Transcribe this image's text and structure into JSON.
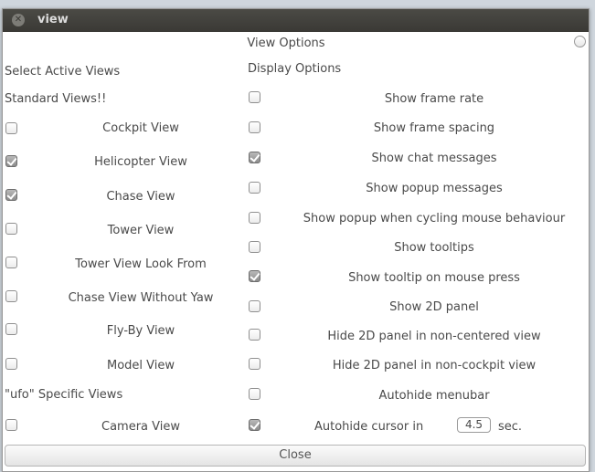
{
  "window": {
    "title": "view",
    "close_icon": "close-icon"
  },
  "header": {
    "title": "View Options"
  },
  "left": {
    "heading": "Select Active Views",
    "standard_label": "Standard Views!!",
    "items": [
      {
        "label": "Cockpit View",
        "checked": false
      },
      {
        "label": "Helicopter View",
        "checked": true
      },
      {
        "label": "Chase View",
        "checked": true
      },
      {
        "label": "Tower View",
        "checked": false
      },
      {
        "label": "Tower View Look From",
        "checked": false
      },
      {
        "label": "Chase View Without Yaw",
        "checked": false
      },
      {
        "label": "Fly-By View",
        "checked": false
      },
      {
        "label": "Model View",
        "checked": false
      }
    ],
    "specific_label": "\"ufo\" Specific Views",
    "specific_items": [
      {
        "label": "Camera View",
        "checked": false
      }
    ]
  },
  "right": {
    "heading": "Display Options",
    "items": [
      {
        "label": "Show frame rate",
        "checked": false
      },
      {
        "label": "Show frame spacing",
        "checked": false
      },
      {
        "label": "Show chat messages",
        "checked": true
      },
      {
        "label": "Show popup messages",
        "checked": false
      },
      {
        "label": "Show popup when cycling mouse behaviour",
        "checked": false
      },
      {
        "label": "Show tooltips",
        "checked": false
      },
      {
        "label": "Show tooltip on mouse press",
        "checked": true
      },
      {
        "label": "Show 2D panel",
        "checked": false
      },
      {
        "label": "Hide 2D panel in non-centered view",
        "checked": false
      },
      {
        "label": "Hide 2D panel in non-cockpit view",
        "checked": false
      },
      {
        "label": "Autohide menubar",
        "checked": false
      },
      {
        "label": "Autohide cursor in",
        "checked": true
      }
    ],
    "cursor_seconds": "4.5",
    "cursor_unit": "sec."
  },
  "footer": {
    "close_label": "Close"
  }
}
